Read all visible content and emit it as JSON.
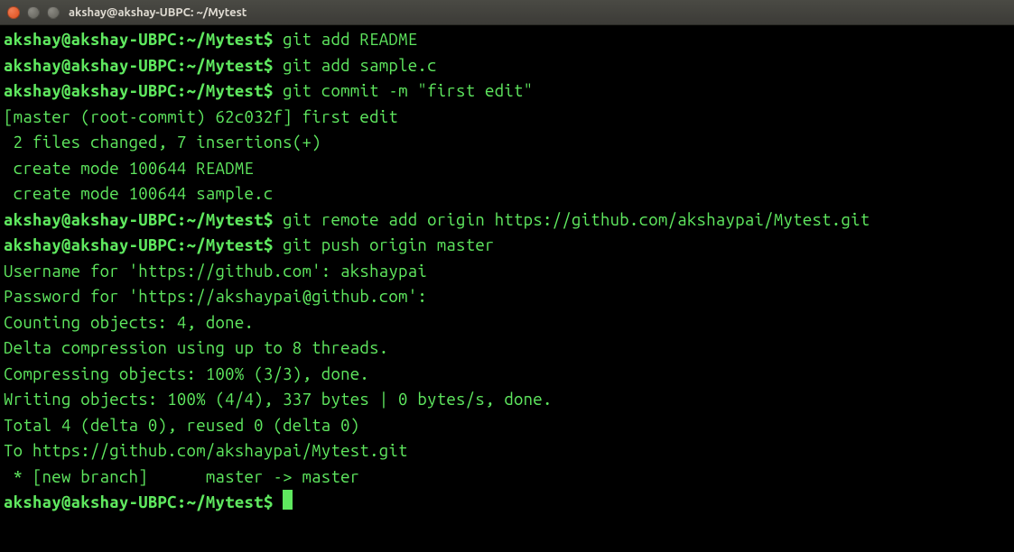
{
  "window": {
    "title": "akshay@akshay-UBPC: ~/Mytest"
  },
  "prompt": {
    "userhost": "akshay@akshay-UBPC",
    "separator": ":",
    "path": "~/Mytest",
    "symbol": "$"
  },
  "lines": [
    {
      "type": "cmd",
      "command": "git add README"
    },
    {
      "type": "cmd",
      "command": "git add sample.c"
    },
    {
      "type": "cmd",
      "command": "git commit -m \"first edit\""
    },
    {
      "type": "out",
      "text": "[master (root-commit) 62c032f] first edit"
    },
    {
      "type": "out",
      "text": " 2 files changed, 7 insertions(+)"
    },
    {
      "type": "out",
      "text": " create mode 100644 README"
    },
    {
      "type": "out",
      "text": " create mode 100644 sample.c"
    },
    {
      "type": "cmd",
      "command": "git remote add origin https://github.com/akshaypai/Mytest.git"
    },
    {
      "type": "cmd",
      "command": "git push origin master"
    },
    {
      "type": "out",
      "text": "Username for 'https://github.com': akshaypai"
    },
    {
      "type": "out",
      "text": "Password for 'https://akshaypai@github.com': "
    },
    {
      "type": "out",
      "text": "Counting objects: 4, done."
    },
    {
      "type": "out",
      "text": "Delta compression using up to 8 threads."
    },
    {
      "type": "out",
      "text": "Compressing objects: 100% (3/3), done."
    },
    {
      "type": "out",
      "text": "Writing objects: 100% (4/4), 337 bytes | 0 bytes/s, done."
    },
    {
      "type": "out",
      "text": "Total 4 (delta 0), reused 0 (delta 0)"
    },
    {
      "type": "out",
      "text": "To https://github.com/akshaypai/Mytest.git"
    },
    {
      "type": "out",
      "text": " * [new branch]      master -> master"
    },
    {
      "type": "prompt_only"
    }
  ]
}
